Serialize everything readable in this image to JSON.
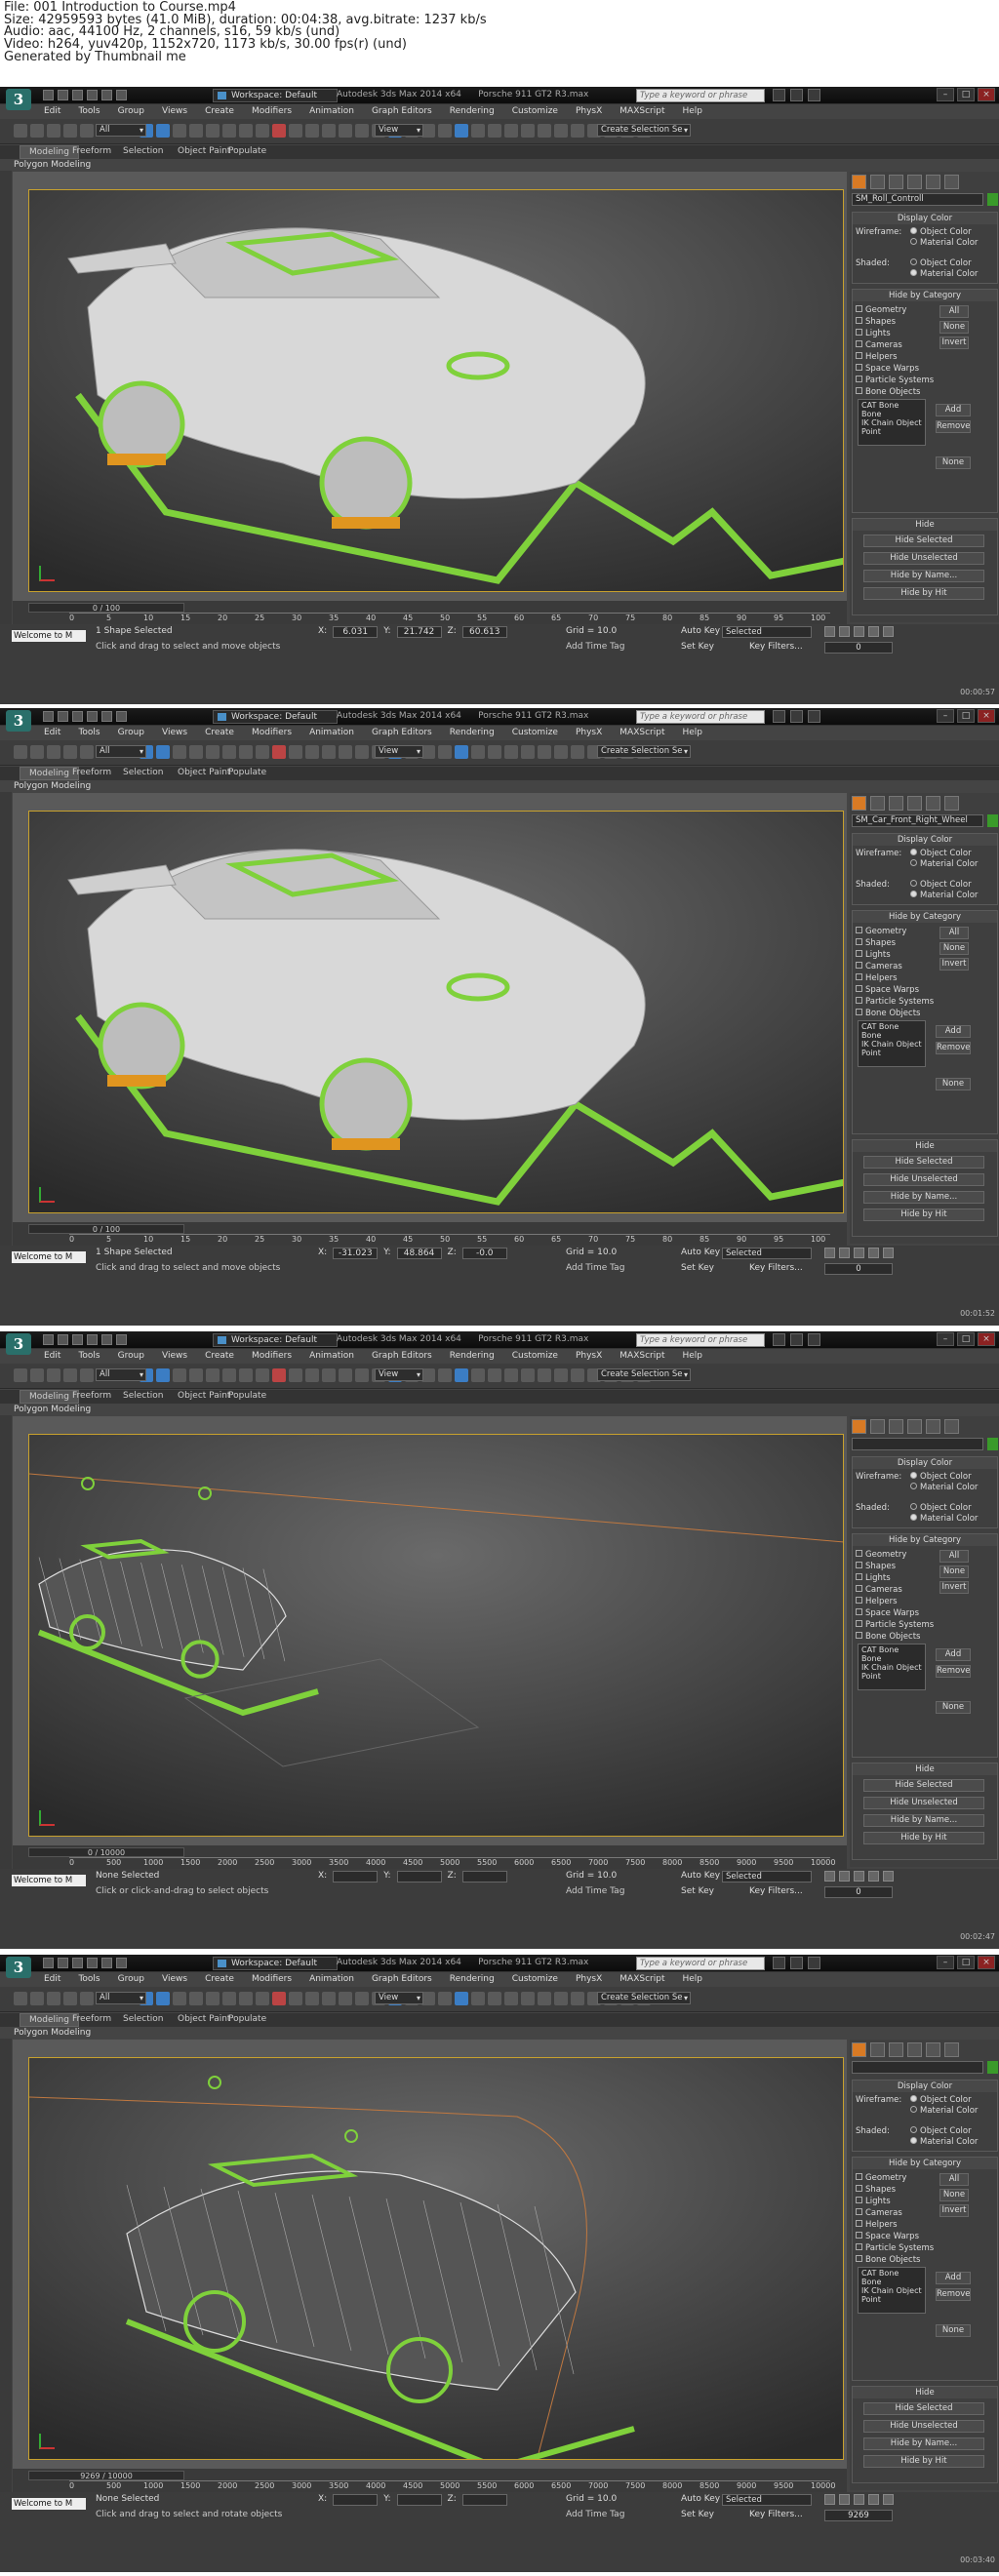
{
  "header": {
    "lines": [
      "File: 001 Introduction to Course.mp4",
      "Size: 42959593 bytes (41.0 MiB), duration: 00:04:38, avg.bitrate: 1237 kb/s",
      "Audio: aac, 44100 Hz, 2 channels, s16, 59 kb/s (und)",
      "Video: h264, yuv420p, 1152x720, 1173 kb/s, 30.00 fps(r) (und)",
      "Generated by Thumbnail me"
    ]
  },
  "app": {
    "title": "Autodesk 3ds Max 2014 x64",
    "search_placeholder": "Type a keyword or phrase",
    "menu": [
      "Edit",
      "Tools",
      "Group",
      "Views",
      "Create",
      "Modifiers",
      "Animation",
      "Graph Editors",
      "Rendering",
      "Customize",
      "MAXScript",
      "Help"
    ],
    "workspace": "Workspace: Default",
    "filter": "All",
    "view_dropdown": "View",
    "ribbon_tabs": [
      "Modeling",
      "Freeform",
      "Selection",
      "Object Paint",
      "Populate"
    ],
    "ribbon_sub": "Polygon Modeling",
    "phx": "PhysX",
    "selection_set": "Create Selection Se"
  },
  "panel": {
    "display_color": "Display Color",
    "wireframe": "Wireframe:",
    "shaded": "Shaded:",
    "object_color": "Object Color",
    "material_color": "Material Color",
    "hide_by_category": "Hide by Category",
    "categories": [
      "Geometry",
      "Shapes",
      "Lights",
      "Cameras",
      "Helpers",
      "Space Warps",
      "Particle Systems",
      "Bone Objects"
    ],
    "cat_buttons": [
      "All",
      "None",
      "Invert"
    ],
    "list_items": [
      "CAT Bone",
      "Bone",
      "IK Chain Object",
      "Point"
    ],
    "list_buttons": [
      "Add",
      "Remove",
      "None"
    ],
    "hide": "Hide",
    "hide_buttons": [
      "Hide Selected",
      "Hide Unselected",
      "Hide by Name...",
      "Hide by Hit"
    ]
  },
  "status": {
    "welcome": "Welcome to M",
    "grid": "Grid = 10.0",
    "add_time_tag": "Add Time Tag",
    "auto_key": "Auto Key",
    "set_key": "Set Key",
    "selected": "Selected",
    "key_filters": "Key Filters..."
  },
  "frames": [
    {
      "scene": "Porsche 911 GT2 R3.max",
      "viewport": "[ + ] [Perspective ] [ Shaded ]",
      "object": "SM_Roll_Controll",
      "time_slider": "0 / 100",
      "ticks": [
        "0",
        "5",
        "10",
        "15",
        "20",
        "25",
        "30",
        "35",
        "40",
        "45",
        "50",
        "55",
        "60",
        "65",
        "70",
        "75",
        "80",
        "85",
        "90",
        "95",
        "100"
      ],
      "selection": "1 Shape Selected",
      "hint": "Click and drag to select and move objects",
      "x": "6.031",
      "y": "21.742",
      "z": "60.613",
      "frame_no": "0",
      "timestamp": "00:00:57",
      "mode": "shaded"
    },
    {
      "scene": "Porsche 911 GT2 R3.max",
      "viewport": "[ + ] [Perspective ] [ Shaded ]",
      "object": "SM_Car_Front_Right_Wheel",
      "time_slider": "0 / 100",
      "ticks": [
        "0",
        "5",
        "10",
        "15",
        "20",
        "25",
        "30",
        "35",
        "40",
        "45",
        "50",
        "55",
        "60",
        "65",
        "70",
        "75",
        "80",
        "85",
        "90",
        "95",
        "100"
      ],
      "selection": "1 Shape Selected",
      "hint": "Click and drag to select and move objects",
      "x": "-31.023",
      "y": "48.864",
      "z": "-0.0",
      "frame_no": "0",
      "timestamp": "00:01:52",
      "mode": "shaded"
    },
    {
      "scene": "Porsche 911 GT2 R3.max",
      "viewport": "[ + ] [Perspective ] [ Shaded + Edged Faces ]",
      "object": "",
      "time_slider": "0 / 10000",
      "ticks": [
        "0",
        "500",
        "1000",
        "1500",
        "2000",
        "2500",
        "3000",
        "3500",
        "4000",
        "4500",
        "5000",
        "5500",
        "6000",
        "6500",
        "7000",
        "7500",
        "8000",
        "8500",
        "9000",
        "9500",
        "10000"
      ],
      "selection": "None Selected",
      "hint": "Click or click-and-drag to select objects",
      "x": "",
      "y": "",
      "z": "",
      "frame_no": "0",
      "timestamp": "00:02:47",
      "mode": "wire"
    },
    {
      "scene": "Porsche 911 GT2 R3.max",
      "viewport": "[ + ] [Perspective ] [ Shaded + Edged Faces ]",
      "object": "",
      "time_slider": "9269 / 10000",
      "ticks": [
        "0",
        "500",
        "1000",
        "1500",
        "2000",
        "2500",
        "3000",
        "3500",
        "4000",
        "4500",
        "5000",
        "5500",
        "6000",
        "6500",
        "7000",
        "7500",
        "8000",
        "8500",
        "9000",
        "9500",
        "10000"
      ],
      "selection": "None Selected",
      "hint": "Click and drag to select and rotate objects",
      "x": "",
      "y": "",
      "z": "",
      "frame_no": "9269",
      "timestamp": "00:03:40",
      "mode": "wire"
    }
  ]
}
